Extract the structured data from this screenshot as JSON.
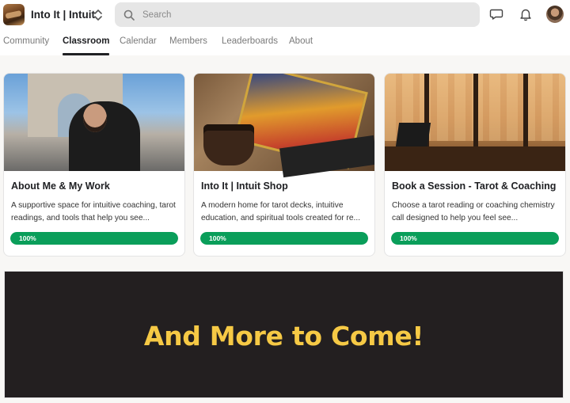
{
  "header": {
    "community_name": "Into It | Intuit",
    "search_placeholder": "Search"
  },
  "nav": {
    "tabs": [
      {
        "label": "Community"
      },
      {
        "label": "Classroom"
      },
      {
        "label": "Calendar"
      },
      {
        "label": "Members"
      },
      {
        "label": "Leaderboards"
      },
      {
        "label": "About"
      }
    ],
    "active_tab": "Classroom"
  },
  "courses": [
    {
      "title": "About Me & My Work",
      "description": "A supportive space for intuitive coaching, tarot readings, and tools that help you see...",
      "progress_label": "100%",
      "progress": 1.0
    },
    {
      "title": "Into It | Intuit Shop",
      "description": "A modern home for tarot decks, intuitive education, and spiritual tools created for re...",
      "progress_label": "100%",
      "progress": 1.0
    },
    {
      "title": "Book a Session - Tarot & Coaching",
      "description": "Choose a tarot reading or coaching chemistry call designed to help you feel see...",
      "progress_label": "100%",
      "progress": 1.0
    }
  ],
  "banner": {
    "text": "And More to Come!"
  },
  "colors": {
    "progress_green": "#0a9e5a",
    "banner_bg": "#231f20",
    "banner_text": "#f6c945"
  },
  "icons": [
    "chevron-updown-icon",
    "search-icon",
    "chat-icon",
    "bell-icon"
  ]
}
